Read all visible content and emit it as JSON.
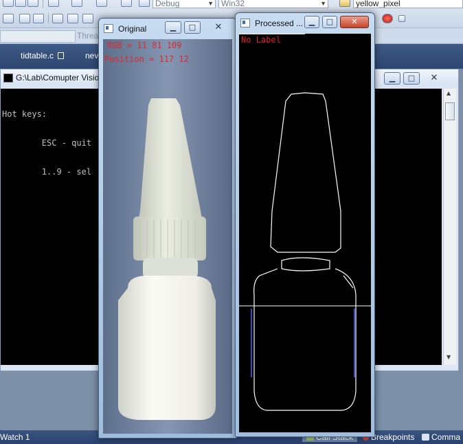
{
  "ide": {
    "toolbar": {
      "config_combo": "Debug",
      "platform_combo": "Win32",
      "find_combo": "yellow_pixel"
    },
    "thread_label": "Threa",
    "tabs": [
      "tidtable.c",
      "nev"
    ],
    "bottom_bar": {
      "watch": "Watch 1",
      "call_stack": "Call Stack",
      "breakpoints": "Breakpoints",
      "command": "Comma"
    },
    "colors": {
      "tab_strip": "#2d466f",
      "title_gradient_top": "#c7dcf1"
    }
  },
  "console": {
    "title": "G:\\Lab\\Comupter Visio",
    "lines": [
      "Hot keys:",
      "        ESC - quit",
      "        1..9 - sel"
    ]
  },
  "windows": {
    "original": {
      "title": "Original",
      "overlay_rgb": "RGB = 11 81 109",
      "overlay_position": "Position = 117 12"
    },
    "processed": {
      "title": "Processed ...",
      "overlay_label": "No Label"
    }
  },
  "icons": [
    "lock-icon",
    "minimize-icon",
    "maximize-icon",
    "close-icon",
    "window-icon"
  ]
}
